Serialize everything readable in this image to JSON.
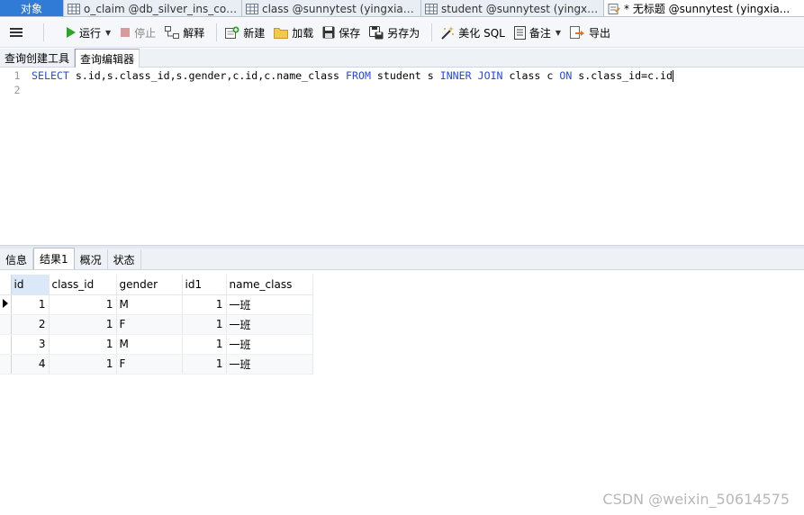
{
  "tabs": {
    "objects": "对象",
    "items": [
      {
        "label": "o_claim @db_silver_ins_core...",
        "icon": "table-icon"
      },
      {
        "label": "class @sunnytest (yingxiaob...",
        "icon": "table-icon"
      },
      {
        "label": "student @sunnytest (yingxia...",
        "icon": "table-icon"
      },
      {
        "label": "* 无标题 @sunnytest (yingxia...",
        "icon": "query-icon"
      }
    ]
  },
  "toolbar": {
    "menu": "menu-icon",
    "run": "运行",
    "stop": "停止",
    "explain": "解释",
    "new": "新建",
    "load": "加载",
    "save": "保存",
    "save_as": "另存为",
    "beautify": "美化 SQL",
    "comment": "备注",
    "export": "导出"
  },
  "editor_tabs": {
    "builder": "查询创建工具",
    "editor": "查询编辑器"
  },
  "editor": {
    "line_numbers": [
      "1",
      "2"
    ],
    "sql_tokens": [
      {
        "t": "SELECT",
        "kw": true
      },
      {
        "t": " s.id,s.class_id,s.gender,c.id,c.name_class ",
        "kw": false
      },
      {
        "t": "FROM",
        "kw": true
      },
      {
        "t": " student s ",
        "kw": false
      },
      {
        "t": "INNER",
        "kw": true
      },
      {
        "t": " ",
        "kw": false
      },
      {
        "t": "JOIN",
        "kw": true
      },
      {
        "t": " class c ",
        "kw": false
      },
      {
        "t": "ON",
        "kw": true
      },
      {
        "t": " s.class_id=c.id",
        "kw": false
      }
    ]
  },
  "result_tabs": {
    "info": "信息",
    "result1": "结果1",
    "profile": "概况",
    "status": "状态"
  },
  "grid": {
    "columns": [
      "id",
      "class_id",
      "gender",
      "id1",
      "name_class"
    ],
    "rows": [
      [
        "1",
        "1",
        "M",
        "1",
        "一班"
      ],
      [
        "2",
        "1",
        "F",
        "1",
        "一班"
      ],
      [
        "3",
        "1",
        "M",
        "1",
        "一班"
      ],
      [
        "4",
        "1",
        "F",
        "1",
        "一班"
      ]
    ]
  },
  "watermark": "CSDN @weixin_50614575",
  "colors": {
    "objects_tab": "#2f7bd6",
    "keyword": "#2747e8",
    "run_icon": "#2aa52a"
  }
}
